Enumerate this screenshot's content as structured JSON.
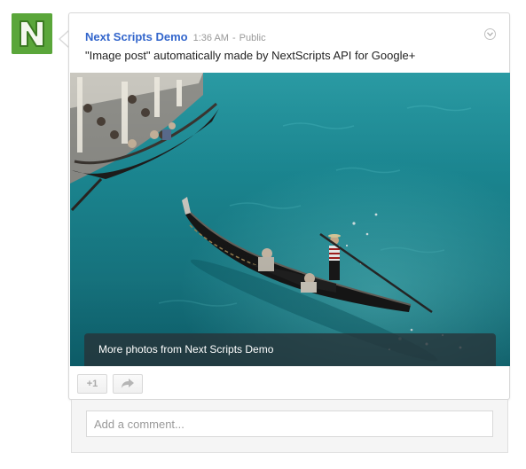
{
  "post": {
    "author": "Next Scripts Demo",
    "time": "1:36 AM",
    "separator": "-",
    "visibility": "Public",
    "text": "\"Image post\" automatically made by NextScripts API for Google+"
  },
  "avatar": {
    "letter": "N",
    "background": "#5aa63a",
    "icon": "n-logo-icon"
  },
  "photo": {
    "caption": "More photos from Next Scripts Demo"
  },
  "actions": {
    "plus_one_label": "+1",
    "share_icon": "share-arrow-icon"
  },
  "comment": {
    "placeholder": "Add a comment..."
  },
  "colors": {
    "author_link": "#3366cc",
    "meta_text": "#999999",
    "water": "#1c8d98"
  }
}
